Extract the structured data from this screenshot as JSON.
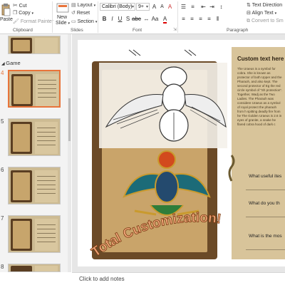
{
  "ribbon": {
    "paste": "Paste",
    "cut": "Cut",
    "copy": "Copy",
    "format_painter": "Format Painter",
    "clipboard_group": "Clipboard",
    "new_slide": "New",
    "new_slide2": "Slide",
    "layout": "Layout",
    "reset": "Reset",
    "section": "Section",
    "slides_group": "Slides",
    "font_name": "Calibri (Body)",
    "font_size": "9+",
    "font_group": "Font",
    "paragraph_group": "Paragraph",
    "text_direction": "Text Direction",
    "align_text": "Align Text",
    "convert_smartart": "Convert to Sm"
  },
  "thumbnails": {
    "section_label": "Game",
    "numbers": [
      "4",
      "5",
      "6",
      "7",
      "8"
    ]
  },
  "slide": {
    "right_title": "Custom text here",
    "right_body": "The Uraeus is a symbol for cobra. She is known as protector of both Upper and the Pharaoh, and also kept. The second protector of Eg the red circle symbol of \"Sh protection\". Together, Wadj as the Two Ladies. The Pharaoh was considere Uraeus as a symbol of royal protect the pharaoh from h spitting deadly fire from he The Golden Uraeus is 2.6 in eyes of granite, a snake he flared cobra hood of dark c",
    "q1": "What useful ites",
    "q2": "What do you th",
    "q3": "What is the mos",
    "banner": "Total Customization!",
    "colors": {
      "accent": "#e8743b",
      "wood": "#6b4a27",
      "parchment": "#d8c49a"
    }
  },
  "notes": {
    "placeholder": "Click to add notes"
  }
}
